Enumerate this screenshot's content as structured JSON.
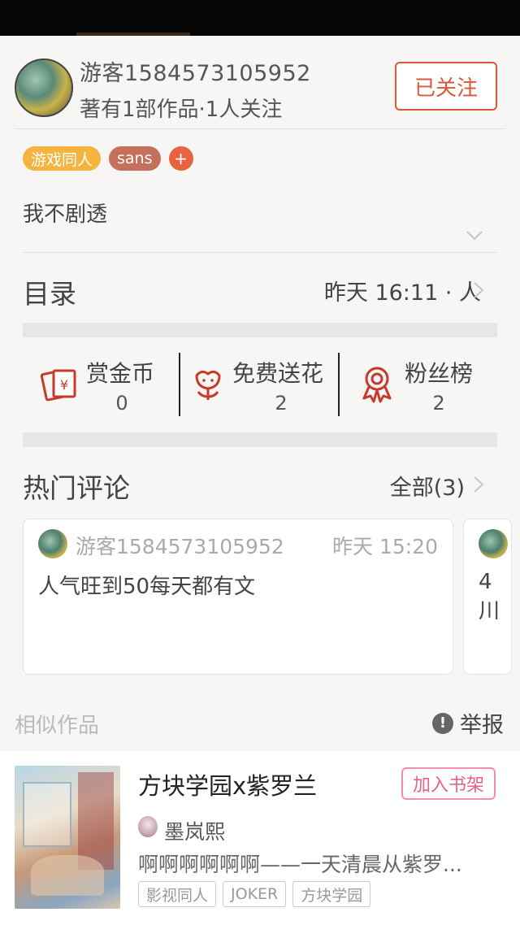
{
  "author": {
    "name": "游客1584573105952",
    "meta": "著有1部作品·1人关注",
    "follow_label": "已关注"
  },
  "tags": [
    "游戏同人",
    "sans"
  ],
  "add_tag_label": "+",
  "intro": "我不剧透",
  "toc": {
    "title": "目录",
    "meta": "昨天 16:11 · 人"
  },
  "stats": [
    {
      "label": "赏金币",
      "value": "0",
      "icon": "red-envelope-icon"
    },
    {
      "label": "免费送花",
      "value": "2",
      "icon": "flower-icon"
    },
    {
      "label": "粉丝榜",
      "value": "2",
      "icon": "medal-icon"
    }
  ],
  "hot_comments": {
    "title": "热门评论",
    "all_label": "全部(3)",
    "comments": [
      {
        "user": "游客1584573105952",
        "time": "昨天 15:20",
        "text": "人气旺到50每天都有文"
      },
      {
        "text": "4川"
      }
    ]
  },
  "similar": {
    "label": "相似作品",
    "report_label": "举报"
  },
  "book": {
    "title": "方块学园x紫罗兰",
    "shelf_label": "加入书架",
    "author": "墨岚熙",
    "description": "啊啊啊啊啊啊——一天清晨从紫罗...",
    "tags": [
      "影视同人",
      "JOKER",
      "方块学园"
    ]
  },
  "colors": {
    "accent": "#d9583a",
    "tag_orange": "#f5b340",
    "tag_brown": "#c4705a",
    "shelf_pink": "#e8608e"
  }
}
